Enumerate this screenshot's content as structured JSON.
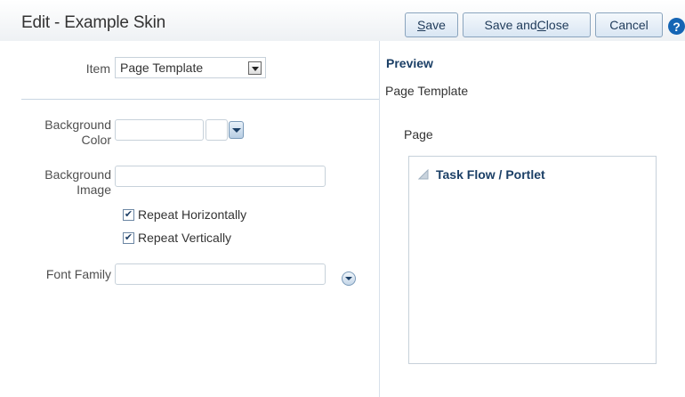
{
  "title": "Edit - Example Skin",
  "buttons": {
    "save": {
      "mnemonic": "S",
      "rest": "ave"
    },
    "save_close": {
      "prefix": "Save and ",
      "mnemonic": "C",
      "rest": "lose"
    },
    "cancel": "Cancel",
    "help": "?"
  },
  "form": {
    "item_label": "Item",
    "item_value": "Page Template",
    "bg_color_label_1": "Background",
    "bg_color_label_2": "Color",
    "bg_color_value": "",
    "bg_image_label_1": "Background",
    "bg_image_label_2": "Image",
    "bg_image_value": "",
    "repeat_h": "Repeat Horizontally",
    "repeat_h_checked": true,
    "repeat_v": "Repeat Vertically",
    "repeat_v_checked": true,
    "font_family_label": "Font Family",
    "font_family_value": ""
  },
  "preview": {
    "heading": "Preview",
    "subheading": "Page Template",
    "page_label": "Page",
    "portlet_title": "Task Flow / Portlet"
  },
  "colors": {
    "accent": "#1b3f66",
    "button_bg": "#d9e6f3",
    "help": "#1565b4"
  }
}
